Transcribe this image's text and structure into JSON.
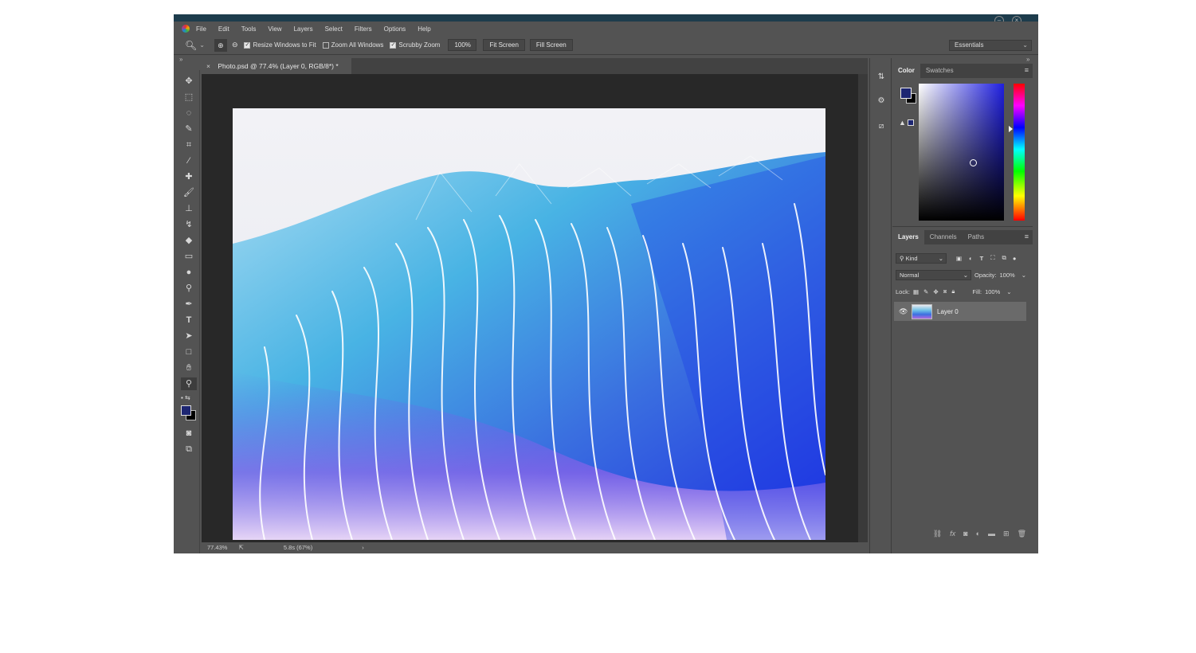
{
  "menubar": {
    "items": [
      "File",
      "Edit",
      "Tools",
      "View",
      "Layers",
      "Select",
      "Filters",
      "Options",
      "Help"
    ]
  },
  "options_bar": {
    "resize_windows_label": "Resize Windows to Fit",
    "resize_windows_checked": true,
    "zoom_all_label": "Zoom All Windows",
    "zoom_all_checked": false,
    "scrubby_zoom_label": "Scrubby Zoom",
    "scrubby_zoom_checked": true,
    "zoom_value": "100%",
    "fit_screen_label": "Fit Screen",
    "fill_screen_label": "Fill Screen"
  },
  "workspace": {
    "selected": "Essentials"
  },
  "document": {
    "tab_title": "Photo.psd @ 77.4% (Layer 0, RGB/8*) *",
    "close_glyph": "×"
  },
  "statusbar": {
    "zoom": "77.43%",
    "info": "5.8s (67%)",
    "arrow": "›"
  },
  "color_panel": {
    "tabs": [
      "Color",
      "Swatches"
    ],
    "active_tab": "Color",
    "foreground": "#1d2672",
    "background": "#000000"
  },
  "layers_panel": {
    "tabs": [
      "Layers",
      "Channels",
      "Paths"
    ],
    "active_tab": "Layers",
    "filter_kind": "Kind",
    "blend_mode": "Normal",
    "opacity_label": "Opacity:",
    "opacity_value": "100%",
    "lock_label": "Lock:",
    "fill_label": "Fill:",
    "fill_value": "100%",
    "layers": [
      {
        "name": "Layer 0",
        "visible": true,
        "selected": true
      }
    ]
  },
  "colors": {
    "app_bg": "#535353",
    "canvas_bg": "#282828",
    "accent": "#1d2672"
  }
}
